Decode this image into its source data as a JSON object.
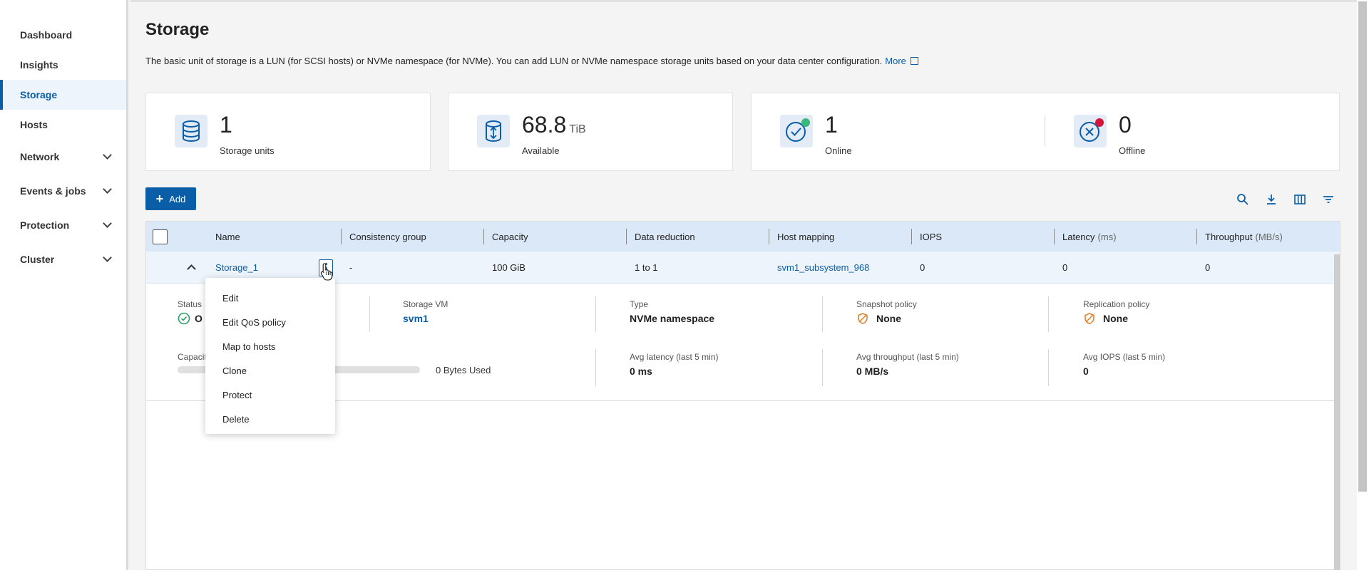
{
  "sidebar": {
    "items": [
      {
        "label": "Dashboard",
        "expandable": false
      },
      {
        "label": "Insights",
        "expandable": false
      },
      {
        "label": "Storage",
        "expandable": false,
        "active": true
      },
      {
        "label": "Hosts",
        "expandable": false
      },
      {
        "label": "Network",
        "expandable": true
      },
      {
        "label": "Events & jobs",
        "expandable": true
      },
      {
        "label": "Protection",
        "expandable": true
      },
      {
        "label": "Cluster",
        "expandable": true
      }
    ]
  },
  "page": {
    "title": "Storage",
    "description": "The basic unit of storage is a LUN (for SCSI hosts) or NVMe namespace (for NVMe). You can add LUN or NVMe namespace storage units based on your data center configuration.",
    "more_link": "More"
  },
  "cards": {
    "storage_units": {
      "value": "1",
      "label": "Storage units",
      "icon": "database-icon"
    },
    "available": {
      "value": "68.8",
      "unit": "TiB",
      "label": "Available",
      "icon": "capacity-icon"
    },
    "online": {
      "value": "1",
      "label": "Online",
      "icon": "check-circle-icon"
    },
    "offline": {
      "value": "0",
      "label": "Offline",
      "icon": "x-circle-icon"
    }
  },
  "toolbar": {
    "add_label": "Add",
    "icons": [
      "search-icon",
      "download-icon",
      "columns-icon",
      "filter-icon"
    ]
  },
  "table": {
    "columns": [
      {
        "label": "Name"
      },
      {
        "label": "Consistency group"
      },
      {
        "label": "Capacity"
      },
      {
        "label": "Data reduction"
      },
      {
        "label": "Host mapping"
      },
      {
        "label": "IOPS"
      },
      {
        "label": "Latency",
        "unit": "(ms)"
      },
      {
        "label": "Throughput",
        "unit": "(MB/s)"
      }
    ],
    "rows": [
      {
        "name": "Storage_1",
        "consistency_group": "-",
        "capacity": "100 GiB",
        "data_reduction": "1 to 1",
        "host_mapping": "svm1_subsystem_968",
        "iops": "0",
        "latency": "0",
        "throughput": "0"
      }
    ]
  },
  "details": {
    "status_label": "Status",
    "status_value": "O",
    "storage_vm_label": "Storage VM",
    "storage_vm_value": "svm1",
    "type_label": "Type",
    "type_value": "NVMe namespace",
    "snapshot_label": "Snapshot policy",
    "snapshot_value": "None",
    "replication_label": "Replication policy",
    "replication_value": "None",
    "capacity_label": "Capacit",
    "capacity_used": "0 Bytes Used",
    "capacity_used_fraction": 0,
    "avg_latency_label": "Avg latency (last 5 min)",
    "avg_latency_value": "0 ms",
    "avg_throughput_label": "Avg throughput (last 5 min)",
    "avg_throughput_value": "0 MB/s",
    "avg_iops_label": "Avg IOPS (last 5 min)",
    "avg_iops_value": "0"
  },
  "menu": {
    "items": [
      "Edit",
      "Edit QoS policy",
      "Map to hosts",
      "Clone",
      "Protect",
      "Delete"
    ]
  },
  "colors": {
    "accent": "#0a5ea8",
    "online_dot": "#3cb97a",
    "offline_dot": "#d4143b",
    "policy_icon": "#e07b1f"
  }
}
